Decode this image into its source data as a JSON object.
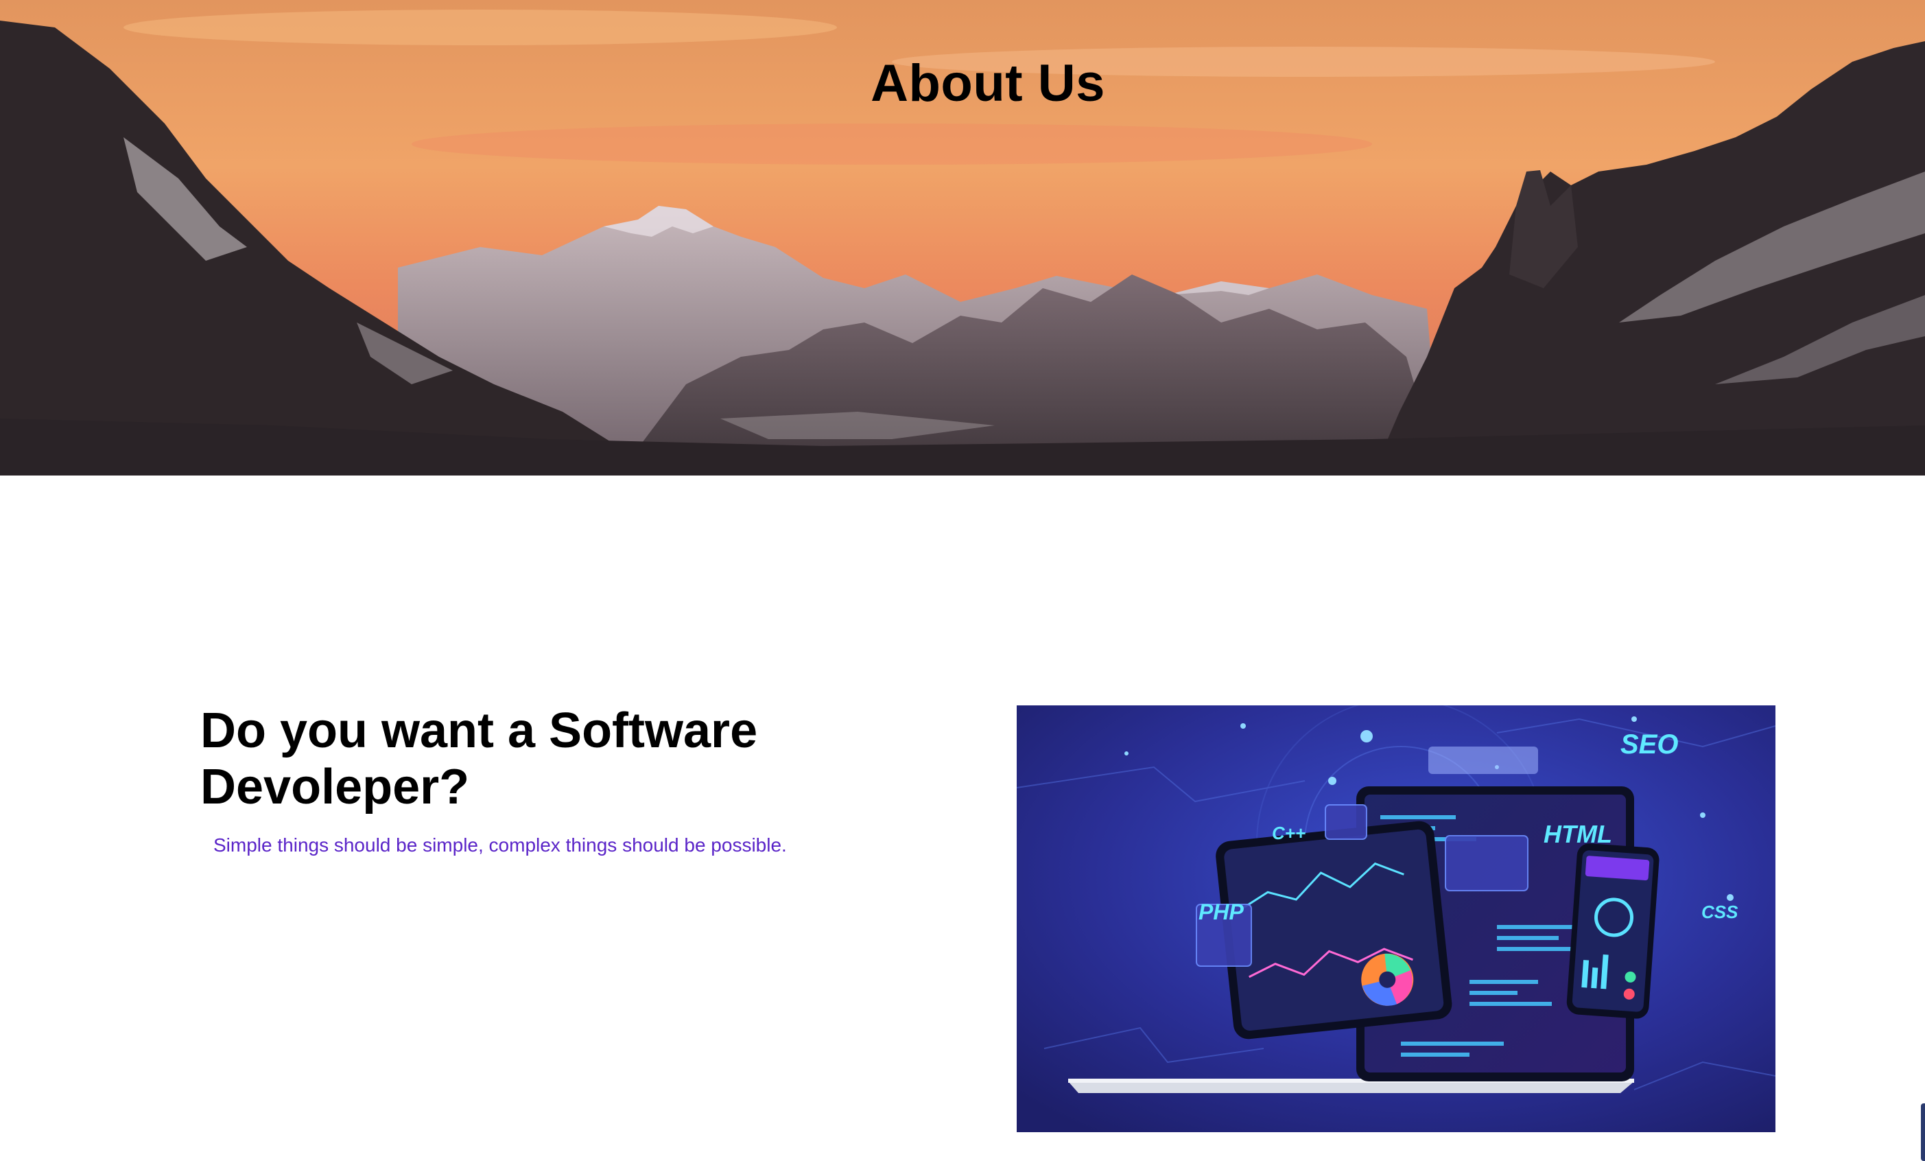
{
  "hero": {
    "title": "About Us"
  },
  "about": {
    "heading": "Do you want a Software Devoleper?",
    "tagline": "Simple things should be simple, complex things should be possible.",
    "illustration": {
      "tags": [
        "SEO",
        "C++",
        "HTML",
        "PHP",
        "CSS"
      ]
    }
  },
  "colors": {
    "tagline": "#5a24c8",
    "sky_top": "#e9a46a",
    "sky_bottom": "#e8825a",
    "illustration_bg": "#2a2f96"
  }
}
